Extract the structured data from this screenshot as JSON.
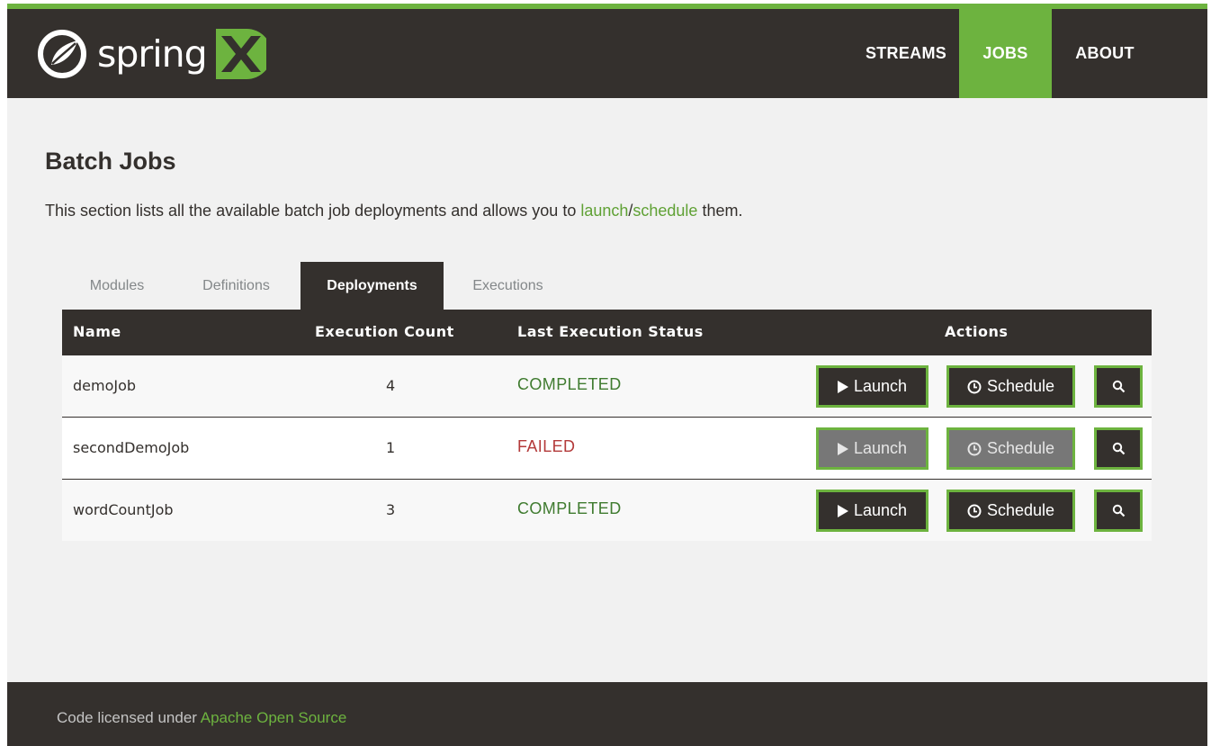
{
  "brand": {
    "logo_text": "spring",
    "accent": "#6db33f",
    "dark": "#34302d"
  },
  "nav": {
    "items": [
      {
        "label": "STREAMS",
        "active": false
      },
      {
        "label": "JOBS",
        "active": true
      },
      {
        "label": "ABOUT",
        "active": false
      }
    ]
  },
  "page": {
    "title": "Batch Jobs",
    "intro_prefix": "This section lists all the available batch job deployments and allows you to ",
    "intro_link1": "launch",
    "intro_sep": "/",
    "intro_link2": "schedule",
    "intro_suffix": " them."
  },
  "tabs": [
    {
      "label": "Modules",
      "active": false
    },
    {
      "label": "Definitions",
      "active": false
    },
    {
      "label": "Deployments",
      "active": true
    },
    {
      "label": "Executions",
      "active": false
    }
  ],
  "table": {
    "headers": {
      "name": "Name",
      "count": "Execution Count",
      "status": "Last Execution Status",
      "actions": "Actions"
    },
    "rows": [
      {
        "name": "demoJob",
        "count": "4",
        "status": "COMPLETED",
        "status_color": "#3f7b2f",
        "enabled": true
      },
      {
        "name": "secondDemoJob",
        "count": "1",
        "status": "FAILED",
        "status_color": "#b33a3a",
        "enabled": false
      },
      {
        "name": "wordCountJob",
        "count": "3",
        "status": "COMPLETED",
        "status_color": "#3f7b2f",
        "enabled": true
      }
    ],
    "launch_label": "Launch",
    "schedule_label": "Schedule"
  },
  "icons": {
    "launch": "play-icon",
    "schedule": "clock-icon",
    "details": "search-icon"
  },
  "footer": {
    "prefix": "Code licensed under ",
    "link": "Apache Open Source"
  }
}
